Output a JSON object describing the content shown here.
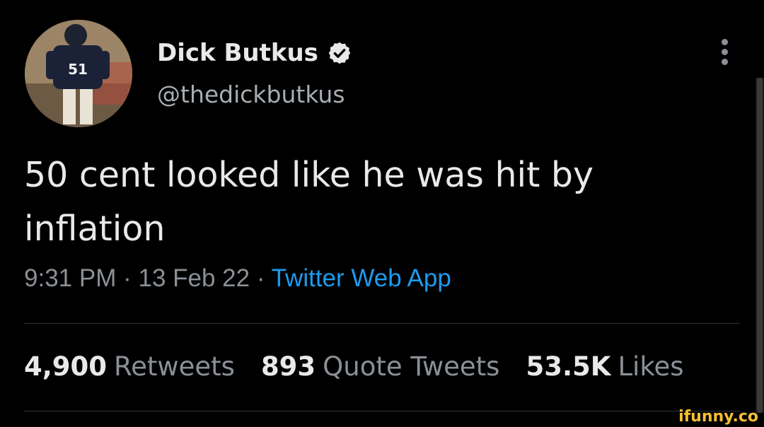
{
  "tweet": {
    "author": {
      "display_name": "Dick Butkus",
      "handle": "@thedickbutkus",
      "verified": true,
      "avatar_jersey_number": "51"
    },
    "text": "50 cent looked like he was hit by inflation",
    "meta": {
      "time": "9:31 PM",
      "separator": "·",
      "date": "13 Feb 22",
      "source": "Twitter Web App"
    },
    "stats": {
      "retweets_count": "4,900",
      "retweets_label": "Retweets",
      "quotes_count": "893",
      "quotes_label": "Quote Tweets",
      "likes_count": "53.5K",
      "likes_label": "Likes"
    }
  },
  "icons": {
    "more": "more-vertical-icon",
    "verified": "verified-badge-icon"
  },
  "watermark": "ifunny.co",
  "colors": {
    "background": "#000000",
    "primary_text": "#e7e9ea",
    "secondary_text": "#8b9096",
    "link": "#1d9bf0",
    "divider": "#2f3336",
    "watermark": "#f6c02f"
  }
}
